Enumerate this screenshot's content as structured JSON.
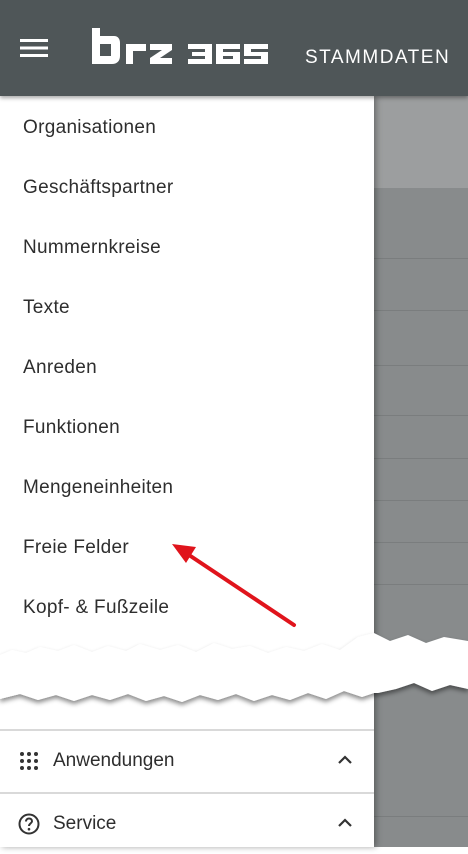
{
  "header": {
    "logo_text": "brz 365",
    "section_title": "STAMMDATEN"
  },
  "drawer": {
    "items": [
      {
        "label": "Organisationen"
      },
      {
        "label": "Geschäftspartner"
      },
      {
        "label": "Nummernkreise"
      },
      {
        "label": "Texte"
      },
      {
        "label": "Anreden"
      },
      {
        "label": "Funktionen"
      },
      {
        "label": "Mengeneinheiten"
      },
      {
        "label": "Freie Felder"
      },
      {
        "label": "Kopf- & Fußzeile"
      }
    ],
    "groups": [
      {
        "label": "Anwendungen",
        "icon": "apps-grid-icon"
      },
      {
        "label": "Service",
        "icon": "help-circle-icon"
      }
    ]
  },
  "annotation": {
    "color": "#e0141c",
    "icon": "red-arrow-annotation"
  },
  "colors": {
    "topbar": "#4f5658",
    "drawer": "#ffffff",
    "text": "#2e2e2e"
  }
}
